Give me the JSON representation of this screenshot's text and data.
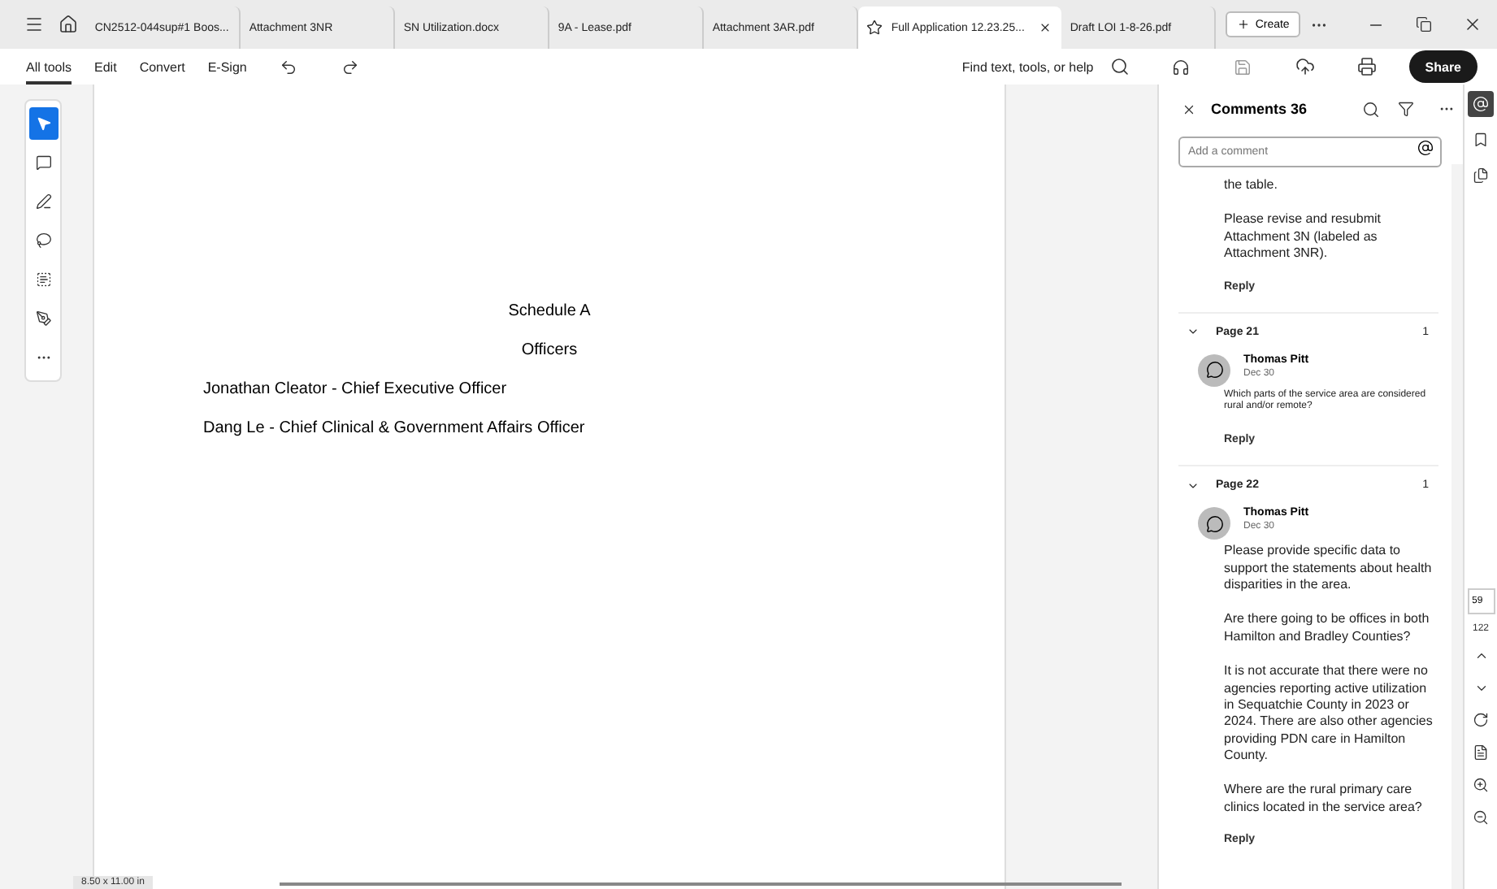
{
  "tabs": [
    {
      "label": "CN2512-044sup#1 Boos...",
      "selected": false
    },
    {
      "label": "Attachment 3NR",
      "selected": false
    },
    {
      "label": "SN Utilization.docx",
      "selected": false
    },
    {
      "label": "9A - Lease.pdf",
      "selected": false
    },
    {
      "label": "Attachment 3AR.pdf",
      "selected": false
    },
    {
      "label": "Full Application 12.23.25...",
      "selected": true
    },
    {
      "label": "Draft LOI 1-8-26.pdf",
      "selected": false
    }
  ],
  "create_button": "Create",
  "menu": [
    {
      "label": "All tools",
      "selected": true
    },
    {
      "label": "Edit",
      "selected": false
    },
    {
      "label": "Convert",
      "selected": false
    },
    {
      "label": "E-Sign",
      "selected": false
    }
  ],
  "search": "Find text, tools, or help",
  "share_button": "Share",
  "tools": [
    {
      "kind": "select",
      "selected": true
    },
    {
      "kind": "comment",
      "selected": false
    },
    {
      "kind": "pen",
      "selected": false
    },
    {
      "kind": "lasso",
      "selected": false
    },
    {
      "kind": "text",
      "selected": false
    },
    {
      "kind": "sign",
      "selected": false
    },
    {
      "kind": "more",
      "selected": false
    }
  ],
  "document": {
    "lines": [
      {
        "text": "Schedule A",
        "kind": "heading"
      },
      {
        "text": "Officers",
        "kind": "heading"
      },
      {
        "text": "Jonathan Cleator - Chief Executive Officer",
        "kind": "line"
      },
      {
        "text": "Dang Le - Chief Clinical & Government Affairs Officer",
        "kind": "line"
      }
    ],
    "page_size": "8.50 x 11.00 in"
  },
  "comments": {
    "title": "Comments 36",
    "placeholder": "Add a comment",
    "sections": [
      {
        "kind": "continuation",
        "paragraphs": [
          "the table.",
          "Please revise and resubmit Attachment 3N (labeled as Attachment 3NR)."
        ],
        "reply": "Reply"
      },
      {
        "kind": "page",
        "page": "Page 21",
        "count": "1",
        "expanded": true,
        "comments": [
          {
            "author": "Thomas Pitt",
            "date": "Dec 30",
            "compact": true,
            "paragraphs": [
              "Which parts of the service area are considered rural and/or remote?"
            ],
            "reply": "Reply"
          }
        ]
      },
      {
        "kind": "page",
        "page": "Page 22",
        "count": "1",
        "expanded": true,
        "comments": [
          {
            "author": "Thomas Pitt",
            "date": "Dec 30",
            "compact": false,
            "paragraphs": [
              "Please provide specific data to support the statements about health disparities in the area.",
              "Are there going to be offices in both Hamilton and Bradley Counties?",
              "It is not accurate that there were no agencies reporting active utilization in Sequatchie County in 2023 or 2024.  There are also other agencies providing PDN care in Hamilton County.",
              "Where are the rural primary care clinics located in the service area?"
            ],
            "reply": "Reply"
          }
        ]
      }
    ]
  },
  "rail": {
    "panels": [
      {
        "kind": "comments",
        "selected": true
      },
      {
        "kind": "bookmarks",
        "selected": false
      },
      {
        "kind": "pages",
        "selected": false
      }
    ],
    "page_number": "59",
    "page_total": "122"
  }
}
